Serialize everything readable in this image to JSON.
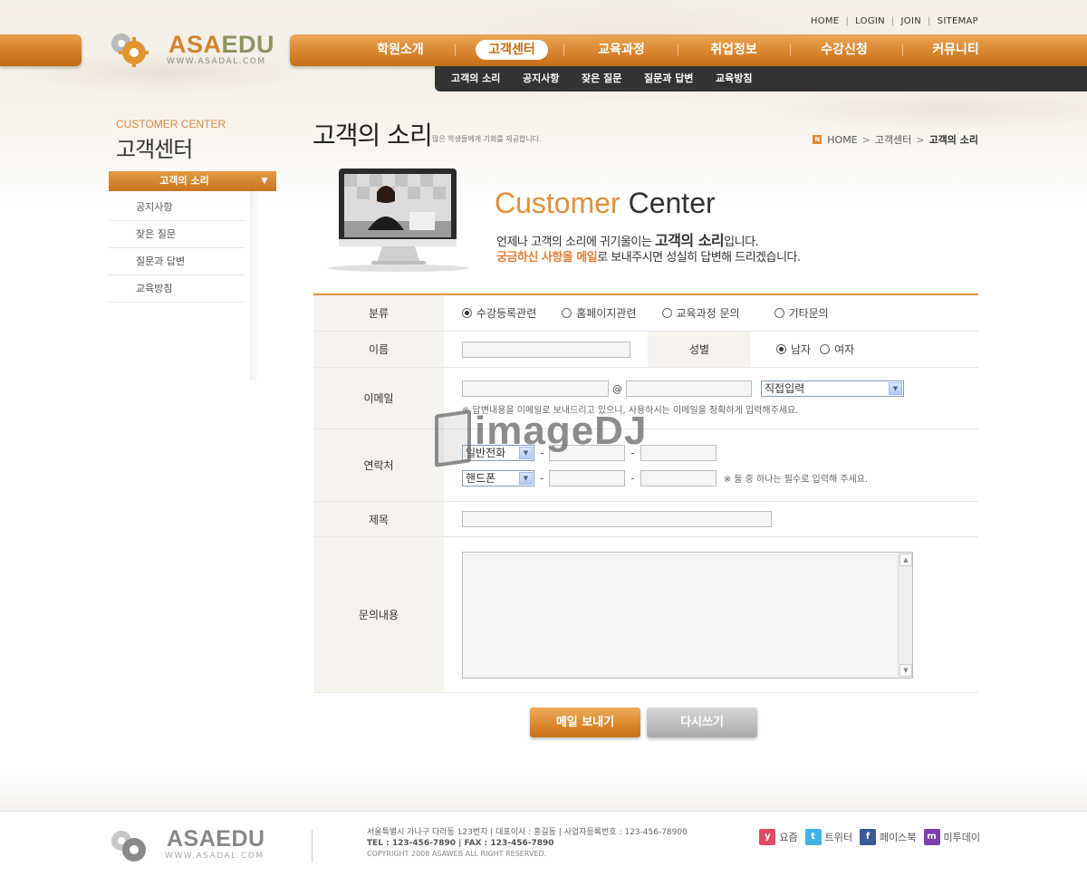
{
  "util_nav": [
    "HOME",
    "LOGIN",
    "JOIN",
    "SITEMAP"
  ],
  "logo": {
    "asa": "ASA",
    "edu": "EDU",
    "url": "WWW.ASADAL.COM"
  },
  "gnb": [
    "학원소개",
    "고객센터",
    "교육과정",
    "취업정보",
    "수강신청",
    "커뮤니티"
  ],
  "snb": [
    "고객의 소리",
    "공지사항",
    "잦은 질문",
    "질문과 답변",
    "교육방침"
  ],
  "side": {
    "title_en": "CUSTOMER CENTER",
    "title_ko": "고객센터",
    "active": "고객의 소리",
    "items": [
      "공지사항",
      "잦은 질문",
      "질문과 답변",
      "교육방침"
    ]
  },
  "page": {
    "title": "고객의 소리",
    "desc": "많은 학생들에게 기회를 제공합니다.",
    "breadcrumb": [
      "HOME",
      "고객센터",
      "고객의 소리"
    ]
  },
  "banner": {
    "en1": "Customer",
    "en2": " Center",
    "line1_a": "언제나 고객의 소리에 귀기울이는 ",
    "line1_big": "고객의 소리",
    "line1_b": "입니다.",
    "line2_hl": "궁금하신 사항을 메일",
    "line2_rest": "로 보내주시면 성실히 답변해 드리겠습니다."
  },
  "form": {
    "category_label": "분류",
    "categories": [
      "수강등록관련",
      "홈페이지관련",
      "교육과정 문의",
      "기타문의"
    ],
    "name_label": "이름",
    "gender_label": "성별",
    "genders": [
      "남자",
      "여자"
    ],
    "email_label": "이메일",
    "email_at": "@",
    "email_select": "직접입력",
    "email_note": "※ 답변내용을 이메일로 보내드리고 있으니, 사용하시는 이메일을 정확하게 입력해주세요.",
    "phone_label": "연락처",
    "phone_select1": "일반전화",
    "phone_select2": "핸드폰",
    "dash": "-",
    "phone_note": "※ 둘 중 하나는 필수로 입력해 주세요.",
    "subject_label": "제목",
    "content_label": "문의내용"
  },
  "buttons": {
    "send": "메일 보내기",
    "reset": "다시쓰기"
  },
  "watermark": "imageDJ",
  "footer": {
    "line1": "서울특별시 가나구 다라동 123번지  |  대표이사 : 홍길동  |  사업자등록번호 : 123-456-78900",
    "line2": "TEL : 123-456-7890  |  FAX : 123-456-7890",
    "copy": "COPYRIGHT 2008 ASAWEB ALL RIGHT RESERVED.",
    "sns": [
      "요즘",
      "트위터",
      "페이스북",
      "미투데이"
    ]
  }
}
